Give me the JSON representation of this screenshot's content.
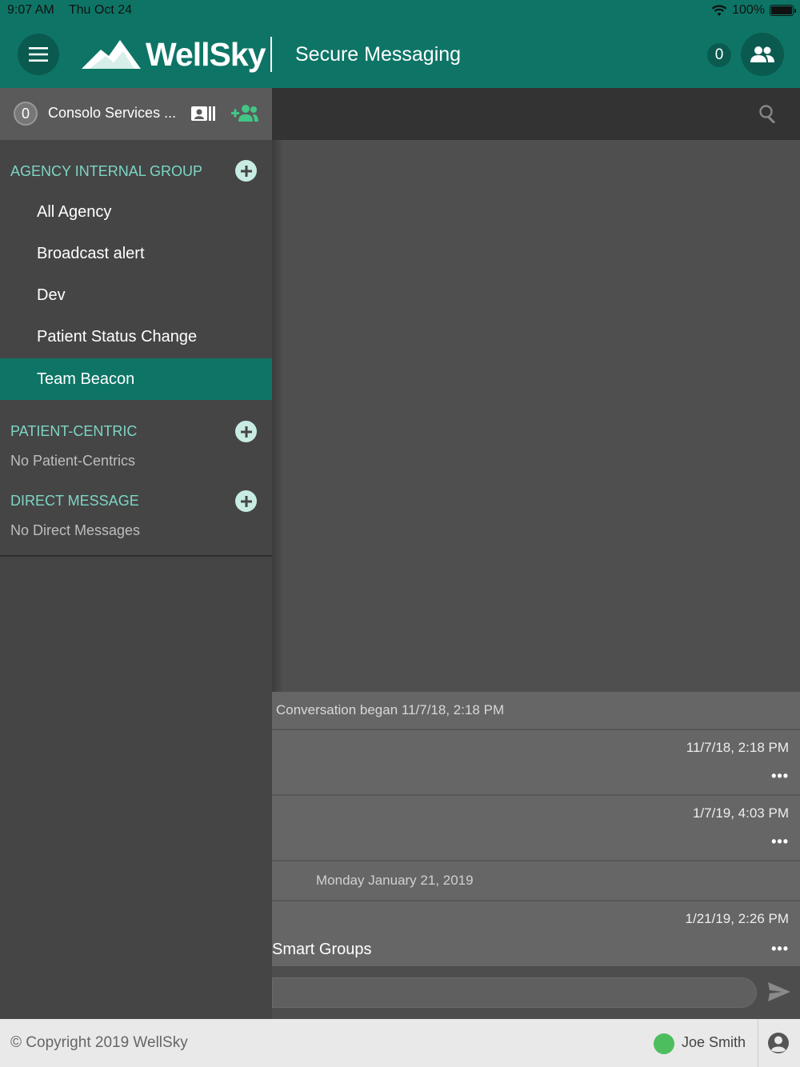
{
  "status_bar": {
    "time": "9:07 AM",
    "date": "Thu Oct 24",
    "battery": "100%"
  },
  "header": {
    "logo": "WellSky",
    "title": "Secure Messaging",
    "notification_count": "0"
  },
  "sidebar": {
    "org": {
      "count": "0",
      "name": "Consolo Services ..."
    },
    "agency_group": {
      "title": "AGENCY INTERNAL GROUP",
      "items": [
        {
          "label": "All Agency"
        },
        {
          "label": "Broadcast alert"
        },
        {
          "label": "Dev"
        },
        {
          "label": "Patient Status Change"
        },
        {
          "label": "Team Beacon",
          "active": true
        }
      ]
    },
    "patient_centric": {
      "title": "PATIENT-CENTRIC",
      "empty": "No Patient-Centrics"
    },
    "direct_message": {
      "title": "DIRECT MESSAGE",
      "empty": "No Direct Messages"
    }
  },
  "conversation": {
    "began": "Conversation began 11/7/18, 2:18 PM",
    "messages": [
      {
        "time": "11/7/18, 2:18 PM",
        "text": ""
      },
      {
        "time": "1/7/19, 4:03 PM",
        "text": ""
      },
      {
        "time": "1/21/19, 2:26 PM",
        "text": "Smart Groups"
      }
    ],
    "day_separator": "Monday January 21, 2019",
    "more": "•••"
  },
  "footer": {
    "copyright": "© Copyright 2019 WellSky",
    "user": "Joe Smith"
  },
  "colors": {
    "primary": "#0e7566",
    "accent": "#7dd6c5",
    "presence": "#4dbe5e"
  }
}
